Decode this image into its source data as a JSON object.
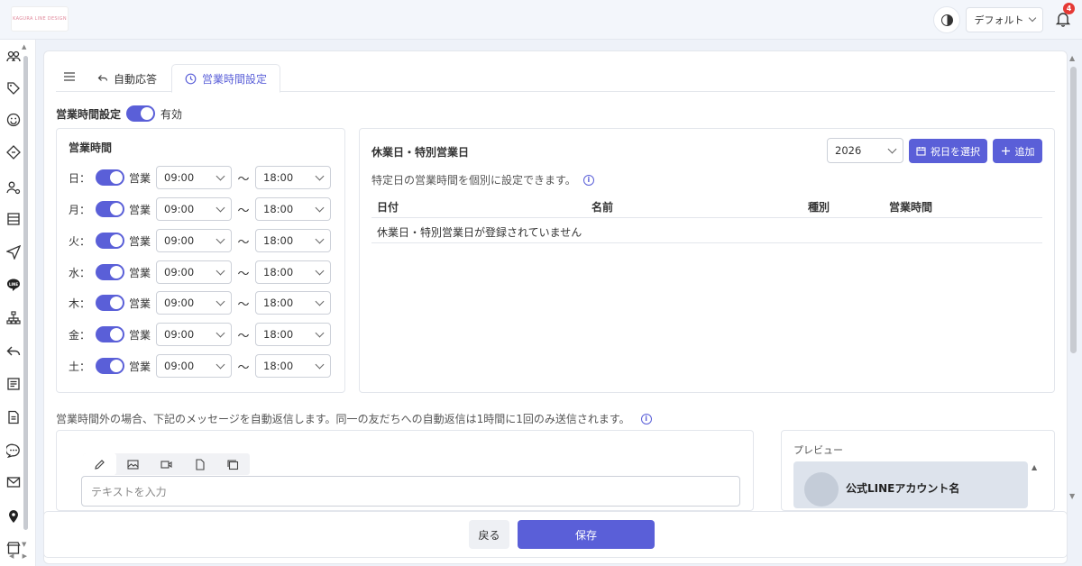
{
  "header": {
    "logo_text": "KAGURA LINE DESIGN",
    "workspace_label": "デフォルト",
    "notification_count": "4"
  },
  "tabs": [
    {
      "label": "自動応答"
    },
    {
      "label": "営業時間設定"
    }
  ],
  "business_hours": {
    "setting_label": "営業時間設定",
    "enabled_label": "有効",
    "enabled": true,
    "section_title": "営業時間",
    "open_label": "営業",
    "separator": "〜",
    "days": [
      {
        "day": "日：",
        "open": true,
        "start": "09:00",
        "end": "18:00"
      },
      {
        "day": "月：",
        "open": true,
        "start": "09:00",
        "end": "18:00"
      },
      {
        "day": "火：",
        "open": true,
        "start": "09:00",
        "end": "18:00"
      },
      {
        "day": "水：",
        "open": true,
        "start": "09:00",
        "end": "18:00"
      },
      {
        "day": "木：",
        "open": true,
        "start": "09:00",
        "end": "18:00"
      },
      {
        "day": "金：",
        "open": true,
        "start": "09:00",
        "end": "18:00"
      },
      {
        "day": "土：",
        "open": true,
        "start": "09:00",
        "end": "18:00"
      }
    ]
  },
  "holidays": {
    "title": "休業日・特別営業日",
    "year": "2026",
    "select_holiday_button": "祝日を選択",
    "add_button": "追加",
    "description": "特定日の営業時間を個別に設定できます。",
    "columns": [
      "日付",
      "名前",
      "種別",
      "営業時間"
    ],
    "empty_message": "休業日・特別営業日が登録されていません"
  },
  "auto_reply": {
    "description": "営業時間外の場合、下記のメッセージを自動返信します。同一の友だちへの自動返信は1時間に1回のみ送信されます。",
    "text_placeholder": "テキストを入力"
  },
  "preview": {
    "label": "プレビュー",
    "account_name": "公式LINEアカウント名"
  },
  "footer": {
    "back_label": "戻る",
    "save_label": "保存"
  },
  "colors": {
    "accent": "#5a5fd8",
    "notification_badge": "#e53935"
  }
}
